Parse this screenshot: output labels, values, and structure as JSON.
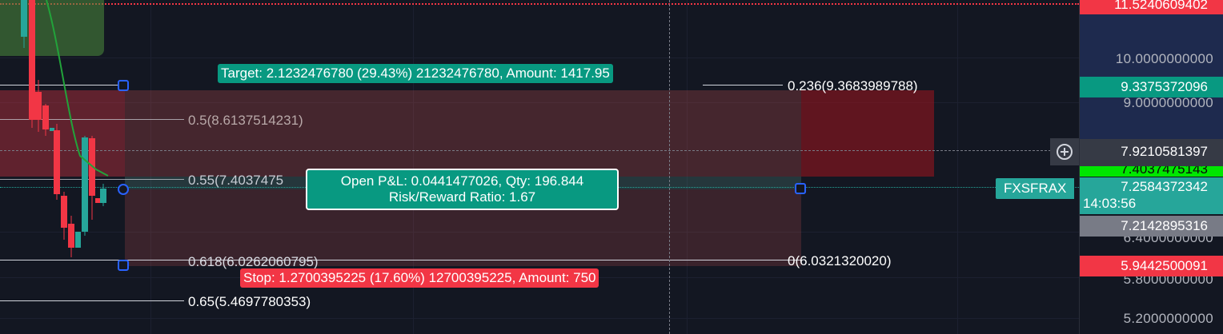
{
  "colors": {
    "background": "#131722",
    "profit_green": "#089981",
    "loss_red": "#f23645",
    "handle_blue": "#2962ff",
    "fib_line": "#d1d4dc",
    "badge_gray": "#787b86",
    "crosshair_badge": "#363a45",
    "bright_green": "#00e600",
    "teal": "#26a69a"
  },
  "fib_levels": {
    "l0236": "0.236(9.3683989788)",
    "l05": "0.5(8.6137514231)",
    "l055": "0.55(7.4037475",
    "l0618": "0.618(6.0262060795)",
    "l065": "0.65(5.4697780353)",
    "l0": "0(6.0321320020)"
  },
  "position_tool": {
    "target_label": "Target: 2.1232476780 (29.43%) 21232476780, Amount: 1417.95",
    "stop_label": "Stop: 1.2700395225 (17.60%) 12700395225, Amount: 750",
    "pnl_line1": "Open P&L: 0.0441477026, Qty: 196.844",
    "pnl_line2": "Risk/Reward Ratio: 1.67"
  },
  "symbol_tag": "FXSFRAX",
  "price_axis": {
    "top_alert": "11.5240609402",
    "tick_10": "10.0000000000",
    "tick_9": "9.0000000000",
    "tick_64": "6.4000000000",
    "tick_58": "5.8000000000",
    "tick_52": "5.2000000000",
    "target_badge": "9.3375372096",
    "crosshair_price": "7.9210581397",
    "green_badge": "7.4037475143",
    "last_price": "7.2584372342",
    "countdown": "14:03:56",
    "gray_badge": "7.2142895316",
    "stop_badge": "5.9442500091"
  },
  "icons": {
    "crosshair_add": "plus-circle-icon"
  }
}
